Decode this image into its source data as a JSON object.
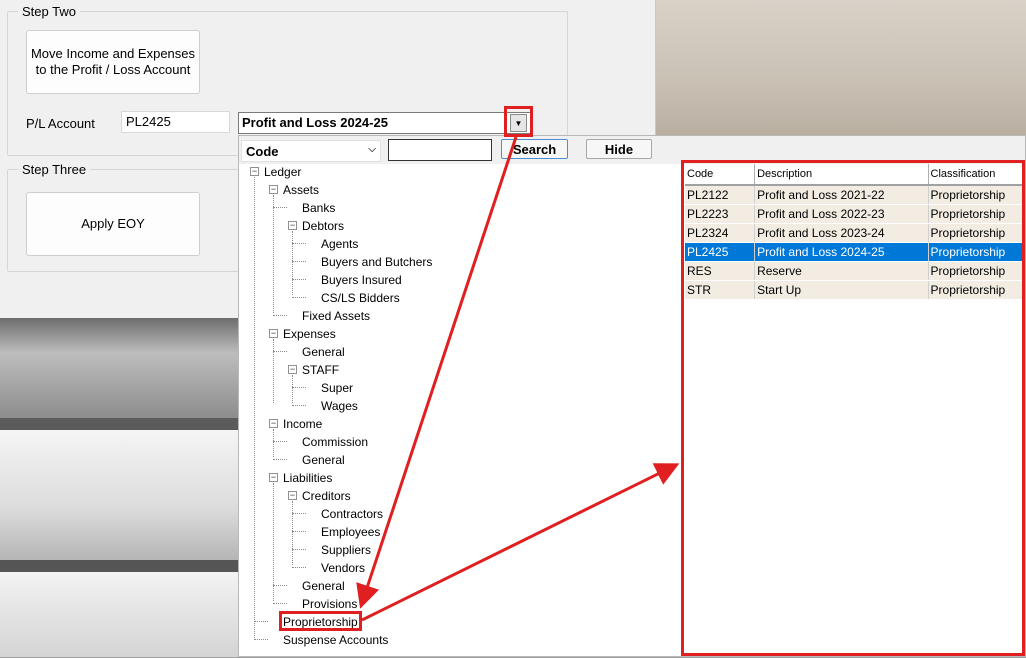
{
  "step_two": {
    "title": "Step Two",
    "move_button": "Move Income and Expenses to the Profit / Loss Account",
    "pl_label": "P/L Account",
    "pl_code": "PL2425",
    "pl_combo_value": "Profit and Loss 2024-25"
  },
  "step_three": {
    "title": "Step Three",
    "apply_button": "Apply EOY"
  },
  "panel": {
    "field_select": "Code",
    "search_value": "",
    "search_button": "Search",
    "hide_button": "Hide"
  },
  "tree": {
    "root": "Ledger",
    "assets": "Assets",
    "banks": "Banks",
    "debtors": "Debtors",
    "agents": "Agents",
    "buyers_butchers": "Buyers and Butchers",
    "buyers_insured": "Buyers Insured",
    "csls_bidders": "CS/LS Bidders",
    "fixed_assets": "Fixed Assets",
    "expenses": "Expenses",
    "exp_general": "General",
    "staff": "STAFF",
    "super": "Super",
    "wages": "Wages",
    "income": "Income",
    "commission": "Commission",
    "inc_general": "General",
    "liabilities": "Liabilities",
    "creditors": "Creditors",
    "contractors": "Contractors",
    "employees": "Employees",
    "suppliers": "Suppliers",
    "vendors": "Vendors",
    "liab_general": "General",
    "provisions": "Provisions",
    "proprietorship": "Proprietorship",
    "suspense": "Suspense Accounts"
  },
  "grid": {
    "headers": [
      "Code",
      "Description",
      "Classification"
    ],
    "rows": [
      [
        "PL2122",
        "Profit and Loss 2021-22",
        "Proprietorship"
      ],
      [
        "PL2223",
        "Profit and Loss 2022-23",
        "Proprietorship"
      ],
      [
        "PL2324",
        "Profit and Loss 2023-24",
        "Proprietorship"
      ],
      [
        "PL2425",
        "Profit and Loss 2024-25",
        "Proprietorship"
      ],
      [
        "RES",
        "Reserve",
        "Proprietorship"
      ],
      [
        "STR",
        "Start Up",
        "Proprietorship"
      ]
    ],
    "selected_row": "PL2425"
  },
  "colors": {
    "annotation": "#e02020",
    "selection": "#0078d7",
    "row_bg": "#f2ece2"
  },
  "icons": {
    "combo_arrow": "dropdown-arrow-icon",
    "tree_expander": "minus-expander-icon"
  }
}
